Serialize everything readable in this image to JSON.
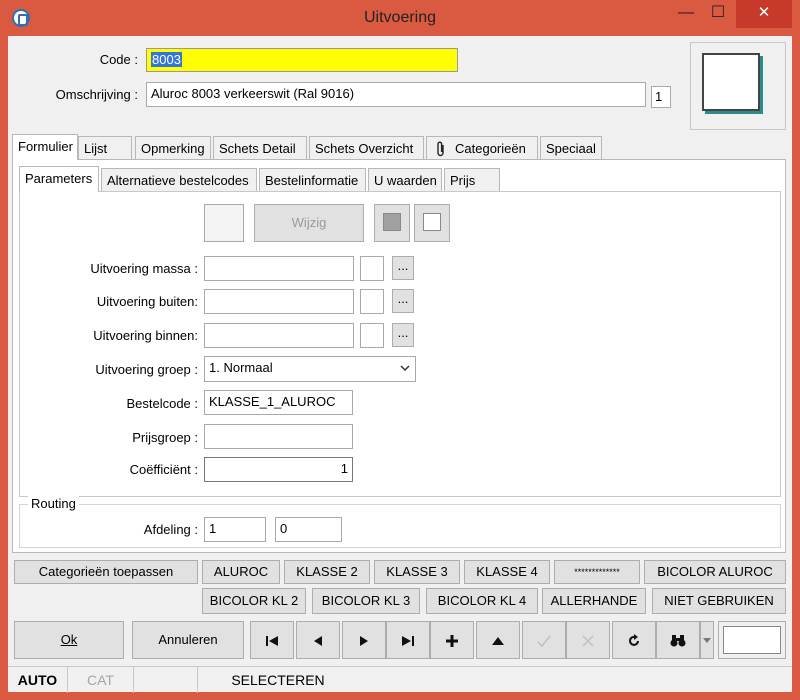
{
  "window": {
    "title": "Uitvoering",
    "minimize": "—",
    "maximize": "☐",
    "close": "✕"
  },
  "header": {
    "code_label": "Code :",
    "code_value": "8003",
    "description_label": "Omschrijving :",
    "description_value": "Aluroc 8003 verkeerswit (Ral 9016)",
    "counter_value": "1"
  },
  "main_tabs": [
    {
      "label": "Formulier",
      "active": true
    },
    {
      "label": "Lijst"
    },
    {
      "label": "Opmerking"
    },
    {
      "label": "Schets Detail"
    },
    {
      "label": "Schets Overzicht"
    },
    {
      "label": "Categorieën",
      "icon": "paperclip-icon"
    },
    {
      "label": "Speciaal"
    }
  ],
  "sub_tabs": [
    {
      "label": "Parameters",
      "active": true
    },
    {
      "label": "Alternatieve bestelcodes"
    },
    {
      "label": "Bestelinformatie"
    },
    {
      "label": "U waarden"
    },
    {
      "label": "Prijs"
    }
  ],
  "color_toolbar": {
    "wijzig_label": "Wijzig"
  },
  "form": {
    "massa_label": "Uitvoering massa :",
    "massa_value": "",
    "buiten_label": "Uitvoering buiten:",
    "buiten_value": "",
    "binnen_label": "Uitvoering binnen:",
    "binnen_value": "",
    "dots_label": "...",
    "groep_label": "Uitvoering groep :",
    "groep_value": "1.  Normaal",
    "bestelcode_label": "Bestelcode :",
    "bestelcode_value": "KLASSE_1_ALUROC",
    "prijsgroep_label": "Prijsgroep :",
    "prijsgroep_value": "",
    "coefficient_label": "Coëfficiënt :",
    "coefficient_value": "1"
  },
  "routing": {
    "title": "Routing",
    "afdeling_label": "Afdeling :",
    "afdeling_value1": "1",
    "afdeling_value2": "0"
  },
  "category_buttons": {
    "apply": "Categorieën toepassen",
    "row1": [
      "ALUROC",
      "KLASSE 2",
      "KLASSE 3",
      "KLASSE 4",
      "*************",
      "BICOLOR ALUROC"
    ],
    "row2": [
      "BICOLOR KL 2",
      "BICOLOR KL 3",
      "BICOLOR KL 4",
      "ALLERHANDE",
      "NIET GEBRUIKEN"
    ]
  },
  "actions": {
    "ok": "Ok",
    "cancel": "Annuleren"
  },
  "statusbar": {
    "auto": "AUTO",
    "cat": "CAT",
    "selecteren": "SELECTEREN"
  },
  "colors": {
    "title_accent": "#da5a41",
    "close_button": "#c7392b",
    "code_highlight": "#ffff00",
    "selection": "#3377d6"
  }
}
